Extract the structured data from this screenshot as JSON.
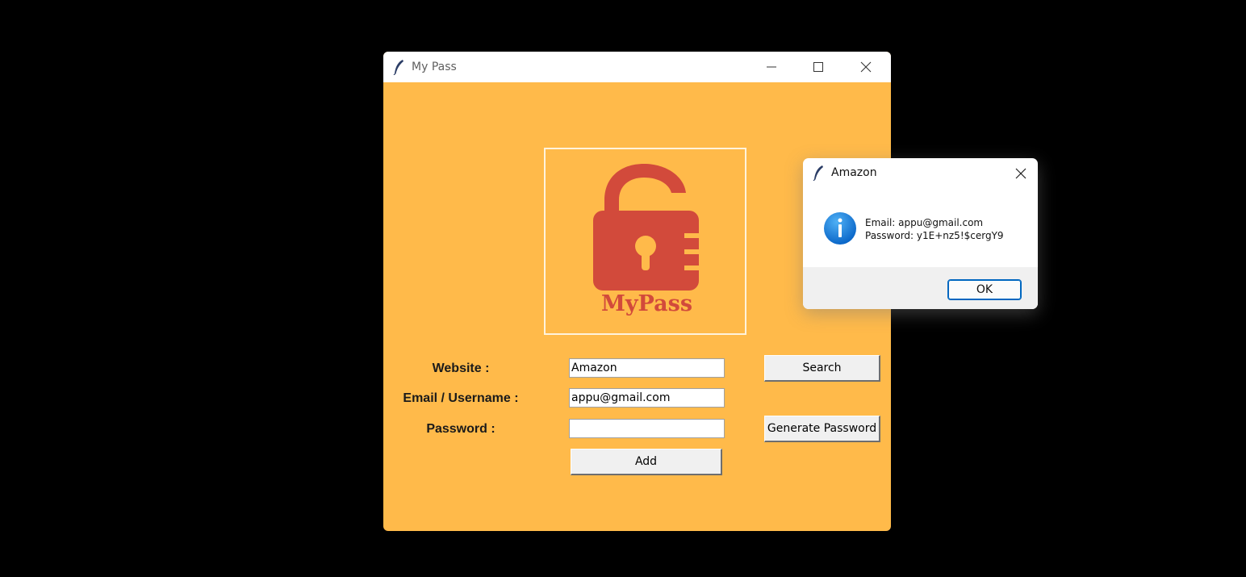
{
  "main_window": {
    "title": "My Pass",
    "logo_text": "MyPass",
    "labels": {
      "website": "Website :",
      "email": "Email / Username :",
      "password": "Password :"
    },
    "fields": {
      "website_value": "Amazon",
      "email_value": "appu@gmail.com",
      "password_value": ""
    },
    "buttons": {
      "search": "Search",
      "generate": "Generate Password",
      "add": "Add"
    },
    "colors": {
      "background": "#ffba4a",
      "logo": "#d24a3b"
    }
  },
  "dialog": {
    "title": "Amazon",
    "message_line1": "Email: appu@gmail.com",
    "message_line2": "Password: y1E+nz5!$cergY9",
    "ok_label": "OK",
    "icon": "info-icon"
  }
}
